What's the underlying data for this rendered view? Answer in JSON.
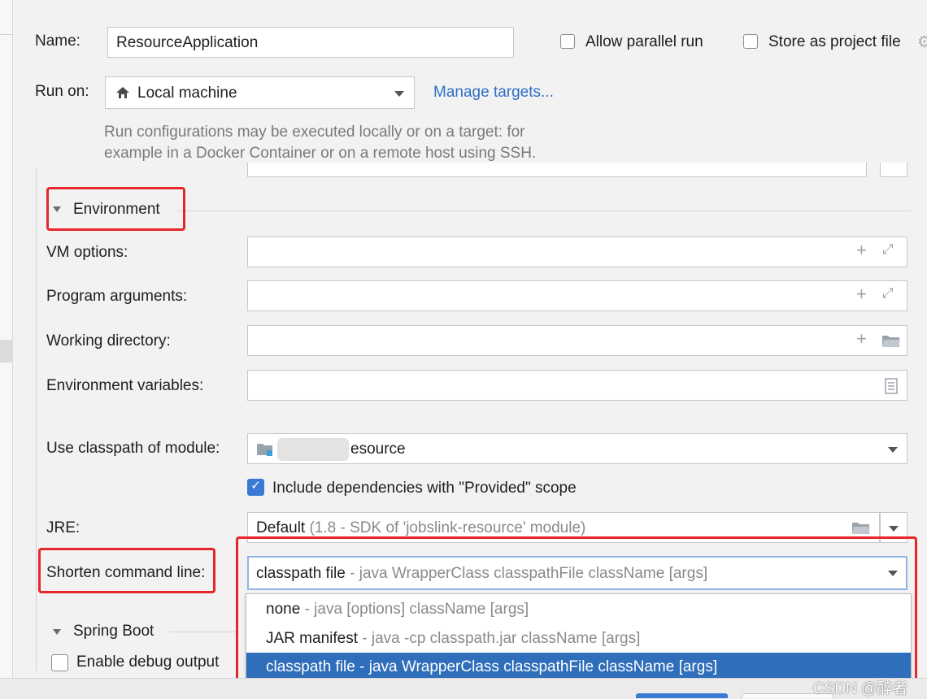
{
  "name": {
    "label": "Name:",
    "value": "ResourceApplication"
  },
  "options": {
    "allow_parallel_run": {
      "label": "Allow parallel run",
      "checked": false
    },
    "store_as_project_file": {
      "label": "Store as project file",
      "checked": false
    }
  },
  "run_on": {
    "label": "Run on:",
    "value": "Local machine",
    "manage_targets": "Manage targets...",
    "hint_line1": "Run configurations may be executed locally or on a target: for",
    "hint_line2": "example in a Docker Container or on a remote host using SSH."
  },
  "environment": {
    "title": "Environment",
    "vm_options": {
      "label": "VM options:",
      "value": ""
    },
    "program_arguments": {
      "label": "Program arguments:",
      "value": ""
    },
    "working_directory": {
      "label": "Working directory:",
      "value": ""
    },
    "environment_variables": {
      "label": "Environment variables:",
      "value": ""
    },
    "module": {
      "label": "Use classpath of module:",
      "value_visible": "esource"
    },
    "include_provided": {
      "label": "Include dependencies with \"Provided\" scope",
      "checked": true
    },
    "jre": {
      "label": "JRE:",
      "value_main": "Default",
      "value_detail": "(1.8 - SDK of 'jobslink-resource' module)"
    },
    "shorten": {
      "label": "Shorten command line:",
      "selected_main": "classpath file",
      "selected_detail": "- java WrapperClass classpathFile className [args]",
      "options": [
        {
          "main": "none",
          "detail": "- java [options] className [args]"
        },
        {
          "main": "JAR manifest",
          "detail": "- java -cp classpath.jar className [args]"
        },
        {
          "main": "classpath file",
          "detail": "- java WrapperClass classpathFile className [args]"
        }
      ]
    }
  },
  "spring_boot": {
    "title": "Spring Boot",
    "debug_output": {
      "label": "Enable debug output",
      "checked": false
    }
  },
  "watermark": "CSDN @醉者"
}
